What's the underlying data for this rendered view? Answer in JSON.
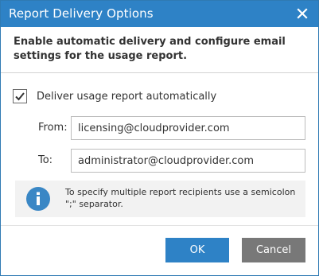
{
  "dialog": {
    "title": "Report Delivery Options",
    "header": "Enable automatic delivery and configure email settings for the usage report.",
    "checkbox_label": "Deliver usage report automatically",
    "checkbox_checked": true,
    "from_label": "From:",
    "from_value": "licensing@cloudprovider.com",
    "to_label": "To:",
    "to_value": "administrator@cloudprovider.com",
    "info_text": "To specify multiple report recipients use a semicolon \";\" separator.",
    "ok_label": "OK",
    "cancel_label": "Cancel"
  },
  "colors": {
    "titlebar": "#2e82c6",
    "ok_button": "#2e82c6",
    "cancel_button": "#787878",
    "info_icon": "#3a87c5"
  },
  "icons": {
    "close": "close-icon",
    "check": "checkmark-icon",
    "info": "info-icon"
  }
}
